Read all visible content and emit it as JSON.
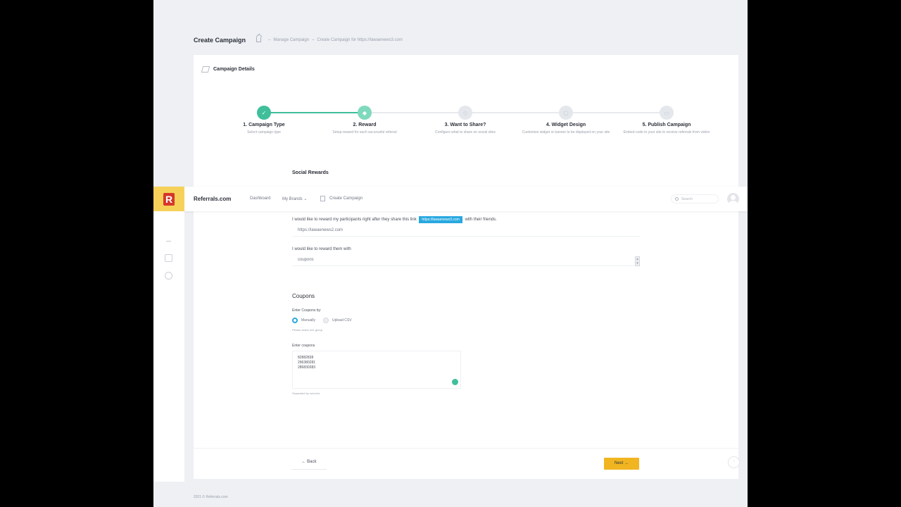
{
  "header": {
    "title": "Create Campaign",
    "breadcrumb": [
      "Manage Campaign",
      "Create Campaign for https://lawaenews3.com"
    ]
  },
  "card": {
    "title": "Campaign Details"
  },
  "steps": [
    {
      "title": "1. Campaign Type",
      "desc": "Select campaign type",
      "state": "done"
    },
    {
      "title": "2. Reward",
      "desc": "Setup reward for each successful referral",
      "state": "active"
    },
    {
      "title": "3. Want to Share?",
      "desc": "Configure what to share on social sites",
      "state": "todo"
    },
    {
      "title": "4. Widget Design",
      "desc": "Customize widget or banner to be displayed on your site",
      "state": "todo"
    },
    {
      "title": "5. Publish Campaign",
      "desc": "Embed code to your site to receive referrals from visitor",
      "state": "todo"
    }
  ],
  "section_label": "Social Rewards",
  "topnav": {
    "logo": "R",
    "brand": "Referrals.com",
    "dashboard": "Dashboard",
    "my_brands": "My Brands",
    "create_campaign": "Create Campaign",
    "search_placeholder": "Search"
  },
  "form": {
    "share_prefix": "I would like to reward my participants right after they share this link",
    "share_link": "https://lawaenews3.com",
    "share_suffix": "with their friends.",
    "url_value": "https://lawaenews2.com",
    "reward_label": "I would like to reward them with",
    "reward_value": "coupons",
    "coupons_heading": "Coupons",
    "enter_by_label": "Enter Coupons by:",
    "radio_manual": "Manually",
    "radio_csv": "Upload CSV",
    "hint": "Please select one group",
    "enter_coupons_label": "Enter coupons",
    "coupons": [
      "82882838",
      "296380281",
      "286830383"
    ],
    "separator_hint": "Separated by new line"
  },
  "footer": {
    "back": "Back",
    "next": "Next"
  },
  "copyright": "2021 © Referrals.com",
  "colors": {
    "accent": "#3fbf9b",
    "link": "#29a8e0",
    "button": "#f1b521"
  }
}
